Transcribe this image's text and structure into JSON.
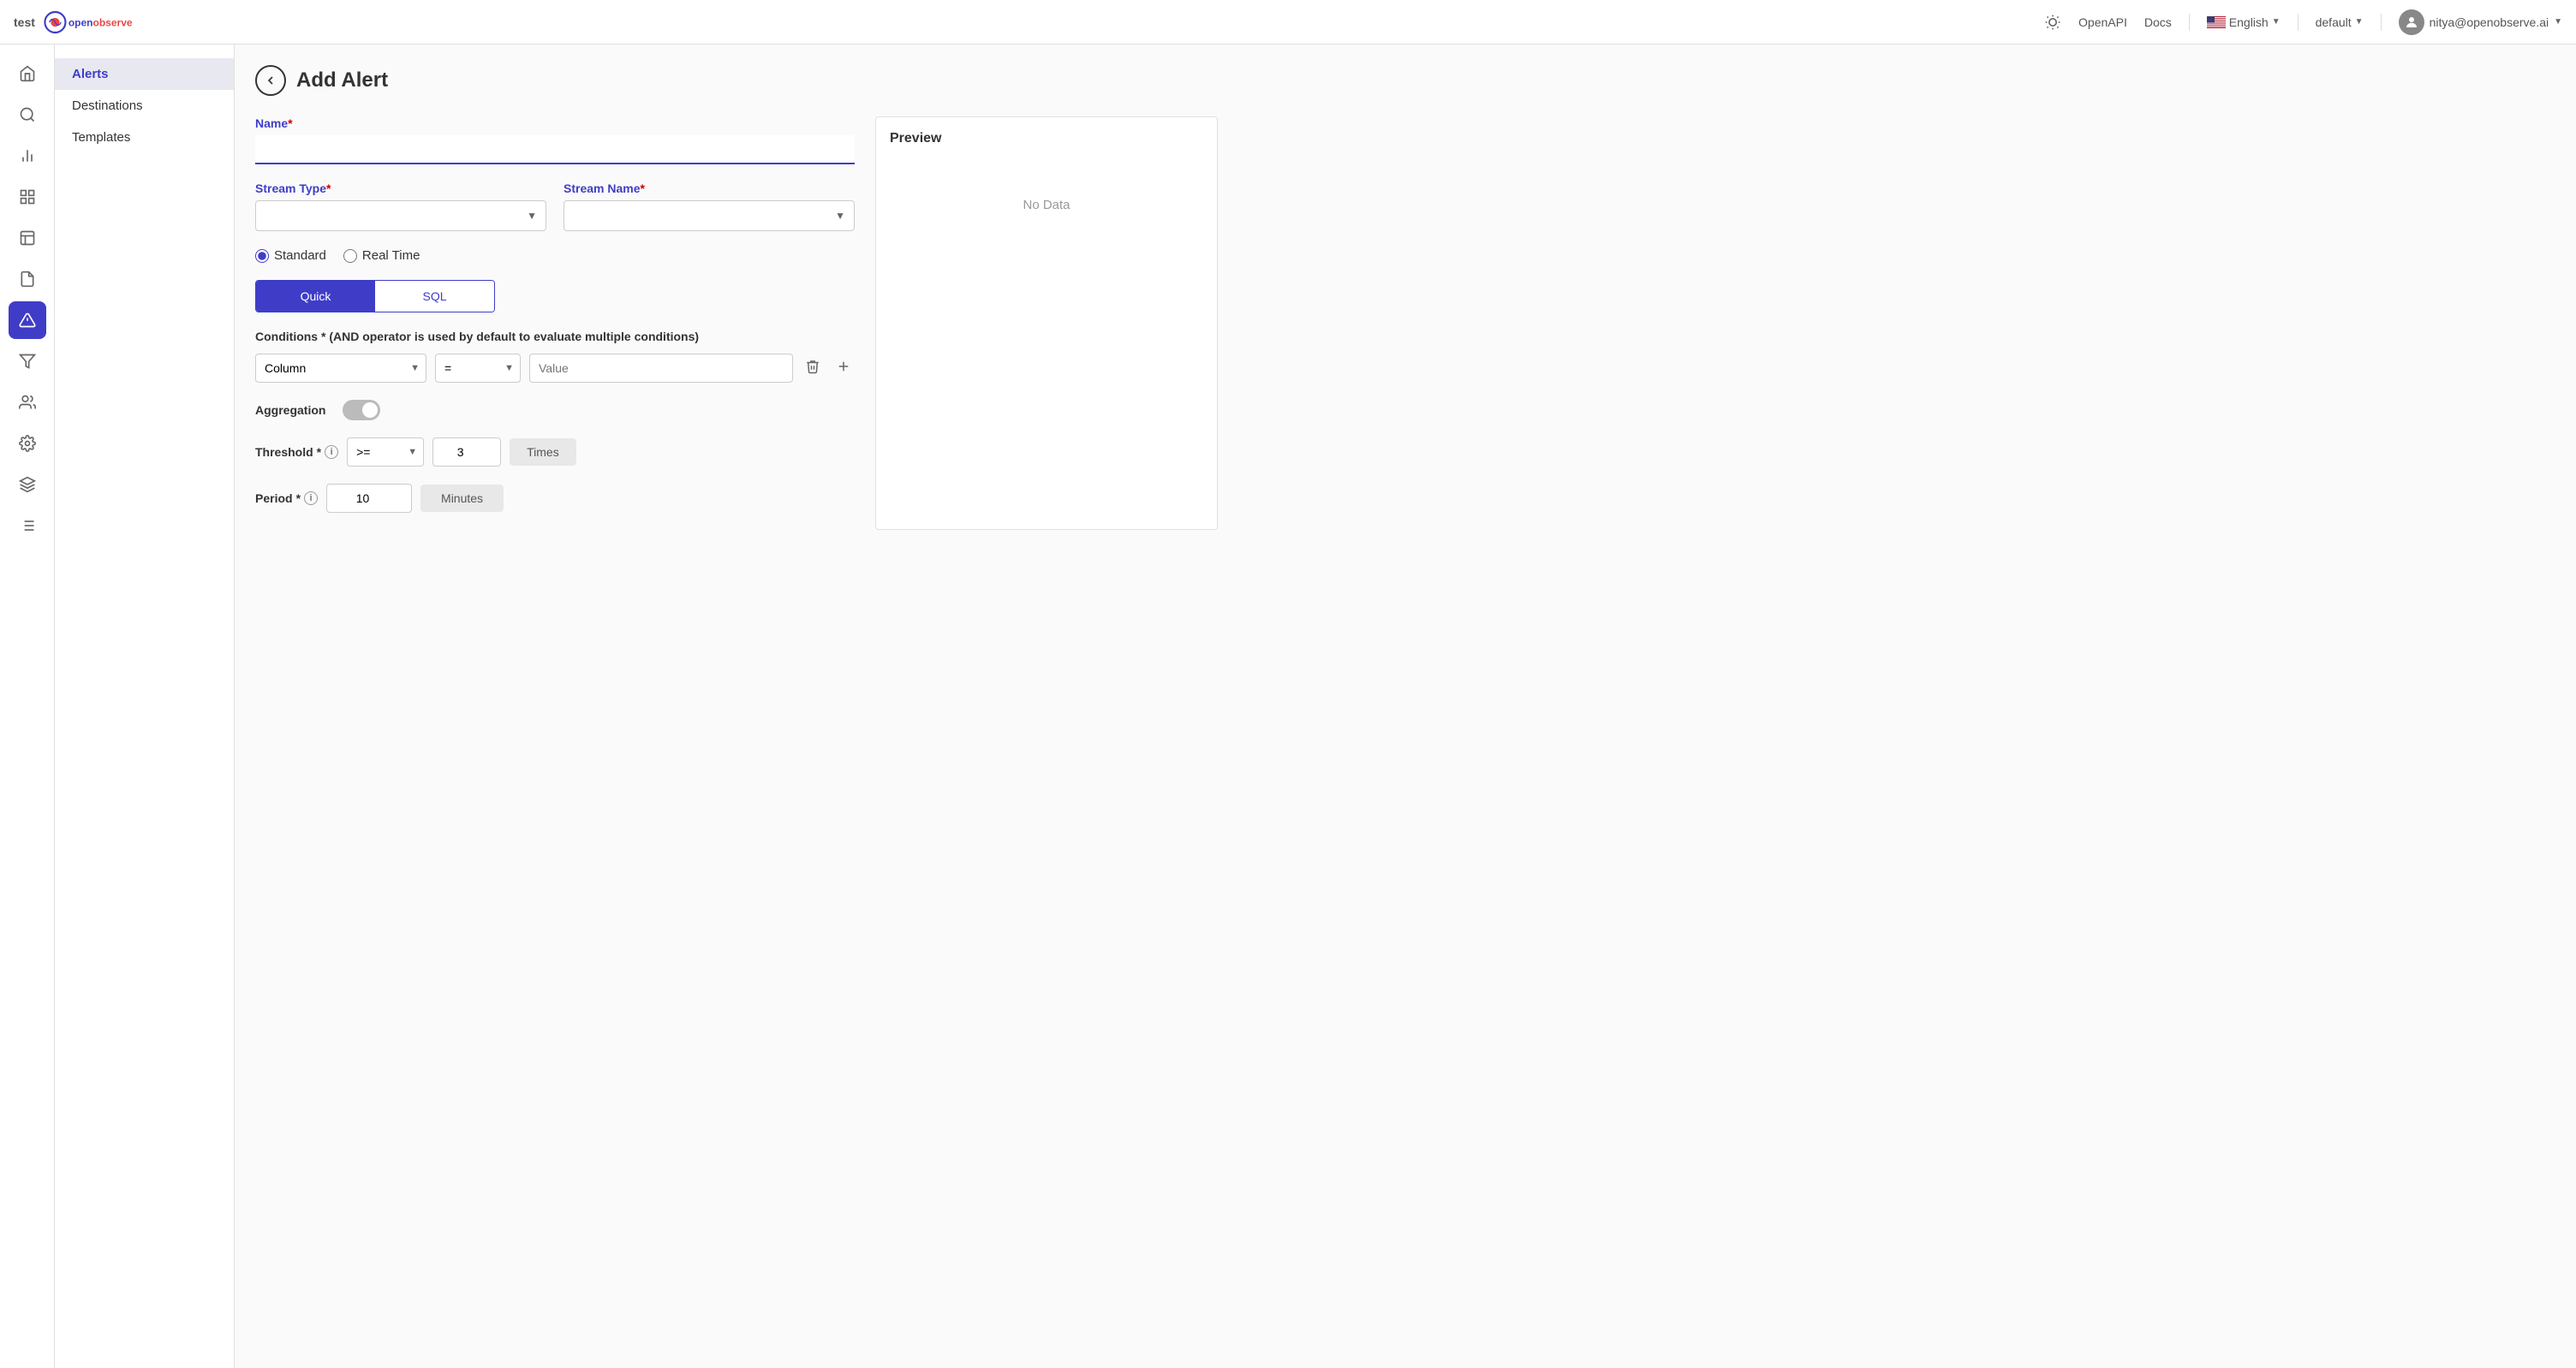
{
  "app": {
    "brand": "test",
    "logo_text": "openobserve"
  },
  "topnav": {
    "openapi_label": "OpenAPI",
    "docs_label": "Docs",
    "language": "English",
    "org": "default",
    "user_email": "nitya@openobserve.ai"
  },
  "sidebar": {
    "items": [
      {
        "id": "home",
        "icon": "⌂",
        "label": "Home"
      },
      {
        "id": "search",
        "icon": "🔍",
        "label": "Search"
      },
      {
        "id": "metrics",
        "icon": "📊",
        "label": "Metrics"
      },
      {
        "id": "streams",
        "icon": "⚡",
        "label": "Streams"
      },
      {
        "id": "dashboard",
        "icon": "⊞",
        "label": "Dashboard"
      },
      {
        "id": "reports",
        "icon": "📄",
        "label": "Reports"
      },
      {
        "id": "alerts",
        "icon": "🔔",
        "label": "Alerts",
        "active": true
      },
      {
        "id": "pipelines",
        "icon": "⧖",
        "label": "Pipelines"
      },
      {
        "id": "iam",
        "icon": "👥",
        "label": "IAM"
      },
      {
        "id": "settings",
        "icon": "⚙",
        "label": "Settings"
      },
      {
        "id": "integrations",
        "icon": "✳",
        "label": "Integrations"
      },
      {
        "id": "logs",
        "icon": "☰",
        "label": "Logs"
      }
    ]
  },
  "sub_sidebar": {
    "items": [
      {
        "id": "alerts",
        "label": "Alerts",
        "active": true
      },
      {
        "id": "destinations",
        "label": "Destinations"
      },
      {
        "id": "templates",
        "label": "Templates"
      }
    ]
  },
  "page": {
    "title": "Add Alert",
    "back_label": "←"
  },
  "form": {
    "name_label": "Name",
    "name_required": "*",
    "name_placeholder": "",
    "stream_type_label": "Stream Type",
    "stream_type_required": "*",
    "stream_name_label": "Stream Name",
    "stream_name_required": "*",
    "standard_label": "Standard",
    "realtime_label": "Real Time",
    "quick_label": "Quick",
    "sql_label": "SQL",
    "conditions_label": "Conditions * (AND operator is used by default to evaluate multiple conditions)",
    "column_placeholder": "Column",
    "operator_default": "=",
    "value_placeholder": "Value",
    "aggregation_label": "Aggregation",
    "threshold_label": "Threshold",
    "threshold_operator": ">=",
    "threshold_value": "3",
    "times_label": "Times",
    "period_label": "Period",
    "period_value": "10",
    "minutes_label": "Minutes"
  },
  "preview": {
    "title": "Preview",
    "no_data": "No Data"
  }
}
